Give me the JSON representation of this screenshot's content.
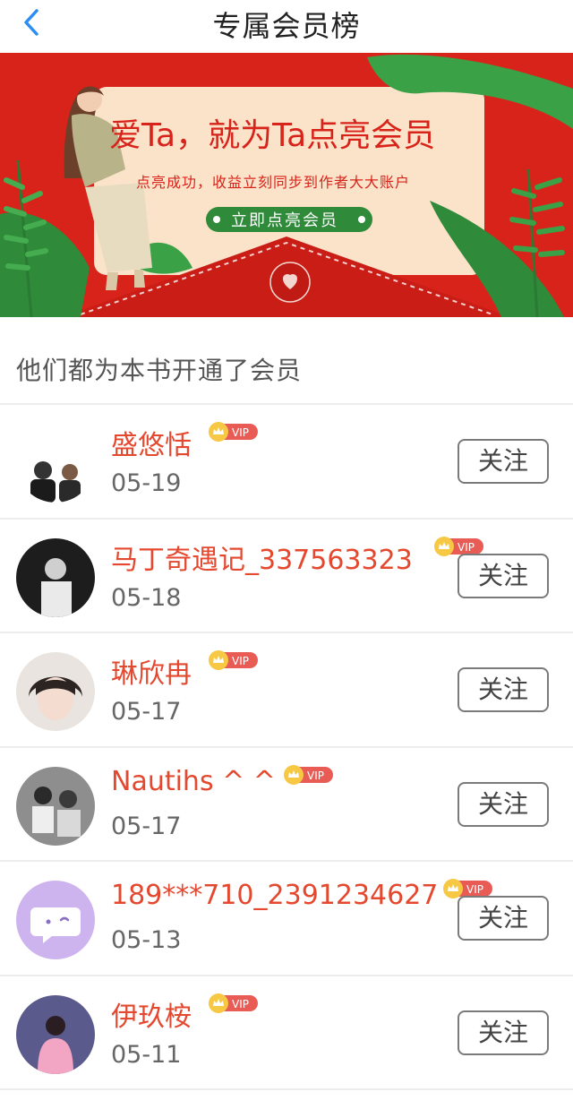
{
  "header": {
    "title": "专属会员榜"
  },
  "banner": {
    "headline": "爱Ta，就为Ta点亮会员",
    "subline": "点亮成功，收益立刻同步到作者大大账户",
    "cta": "立即点亮会员"
  },
  "section": {
    "title": "他们都为本书开通了会员"
  },
  "vip_label": "VIP",
  "follow_label": "关注",
  "colors": {
    "accent": "#e4482e",
    "banner_red": "#d8231b",
    "cta_green": "#2f8a3a",
    "back_blue": "#2b8ef0"
  },
  "members": [
    {
      "name": "盛悠恬",
      "date": "05-19",
      "avatar": "couple-illustration"
    },
    {
      "name": "马丁奇遇记_337563323",
      "date": "05-18",
      "avatar": "dark-photo-person"
    },
    {
      "name": "琳欣冉",
      "date": "05-17",
      "avatar": "anime-boy"
    },
    {
      "name": "Nautihs ^ ^",
      "date": "05-17",
      "avatar": "two-people-photo"
    },
    {
      "name": "189***710_2391234627",
      "date": "05-13",
      "avatar": "default-chat-avatar"
    },
    {
      "name": "伊玖桉",
      "date": "05-11",
      "avatar": "pink-dress-girl"
    }
  ]
}
